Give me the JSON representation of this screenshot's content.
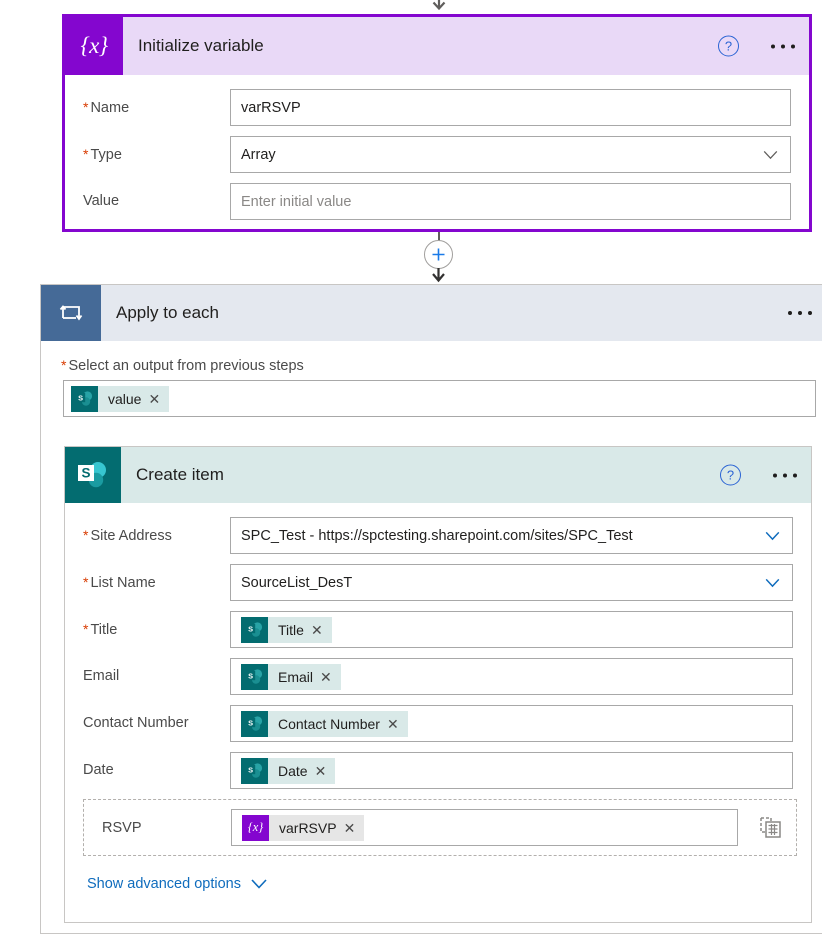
{
  "flow": {
    "incoming_arrow_icon": "arrow-down-icon",
    "connector": {
      "add_button_icon": "plus-circle-icon",
      "arrow_icon": "arrow-down-icon"
    }
  },
  "initialize_variable": {
    "title": "Initialize variable",
    "icon": "variable-braces-icon",
    "icon_glyph": "{x}",
    "help_icon": "help-circle-icon",
    "help_glyph": "?",
    "more_icon": "ellipsis-icon",
    "accent_color": "#8406cf",
    "header_bg": "#e9d9f7",
    "fields": [
      {
        "label": "Name",
        "required": true,
        "value": "varRSVP",
        "type": "text"
      },
      {
        "label": "Type",
        "required": true,
        "value": "Array",
        "type": "select"
      },
      {
        "label": "Value",
        "required": false,
        "value": "",
        "placeholder": "Enter initial value",
        "type": "text"
      }
    ]
  },
  "apply_to_each": {
    "title": "Apply to each",
    "icon": "loop-repeat-icon",
    "more_icon": "ellipsis-icon",
    "header_bg": "#e4e8ef",
    "icon_bg": "#456a97",
    "select_output": {
      "label": "Select an output from previous steps",
      "required": true,
      "token": {
        "label": "value",
        "icon": "sharepoint-icon",
        "remove_icon": "close-icon",
        "kind": "sharepoint"
      }
    }
  },
  "create_item": {
    "title": "Create item",
    "icon": "sharepoint-icon",
    "help_icon": "help-circle-icon",
    "help_glyph": "?",
    "more_icon": "ellipsis-icon",
    "header_bg": "#d9e9e8",
    "icon_bg": "#036c70",
    "fields": [
      {
        "label": "Site Address",
        "required": true,
        "type": "select",
        "value": "SPC_Test - https://spctesting.sharepoint.com/sites/SPC_Test"
      },
      {
        "label": "List Name",
        "required": true,
        "type": "select",
        "value": "SourceList_DesT"
      },
      {
        "label": "Title",
        "required": true,
        "type": "token",
        "token": {
          "label": "Title",
          "icon": "sharepoint-icon",
          "remove_icon": "close-icon",
          "kind": "sharepoint"
        }
      },
      {
        "label": "Email",
        "required": false,
        "type": "token",
        "token": {
          "label": "Email",
          "icon": "sharepoint-icon",
          "remove_icon": "close-icon",
          "kind": "sharepoint"
        }
      },
      {
        "label": "Contact Number",
        "required": false,
        "type": "token",
        "token": {
          "label": "Contact Number",
          "icon": "sharepoint-icon",
          "remove_icon": "close-icon",
          "kind": "sharepoint"
        }
      },
      {
        "label": "Date",
        "required": false,
        "type": "token",
        "token": {
          "label": "Date",
          "icon": "sharepoint-icon",
          "remove_icon": "close-icon",
          "kind": "sharepoint"
        }
      }
    ],
    "rsvp_row": {
      "label": "RSVP",
      "required": false,
      "token": {
        "label": "varRSVP",
        "icon": "variable-braces-icon",
        "icon_glyph": "{x}",
        "remove_icon": "close-icon",
        "kind": "variable"
      },
      "action_icon": "copy-table-icon"
    },
    "advanced_options": {
      "label": "Show advanced options",
      "chevron_icon": "chevron-down-icon",
      "link_color": "#0f6cbd"
    }
  }
}
